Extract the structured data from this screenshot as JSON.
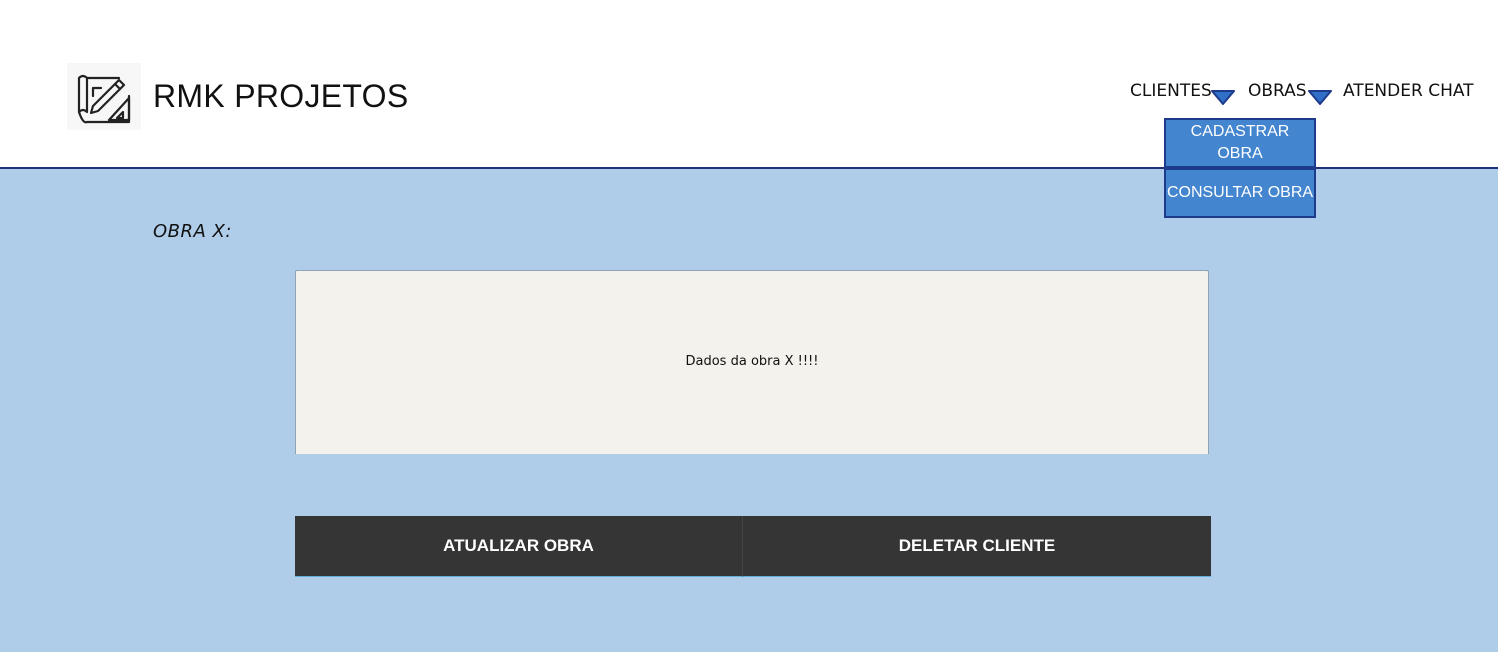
{
  "header": {
    "brand": "RMK PROJETOS",
    "logo_icon": "blueprint-pencil-icon"
  },
  "nav": {
    "clientes_label": "CLIENTES",
    "obras_label": "OBRAS",
    "chat_label": "ATENDER CHAT",
    "caret_icon": "caret-down-icon"
  },
  "obras_menu": {
    "items": [
      {
        "label": "CADASTRAR OBRA"
      },
      {
        "label": "CONSULTAR OBRA"
      }
    ]
  },
  "main": {
    "title": "OBRA X:",
    "details_text": "Dados da obra X !!!!"
  },
  "actions": {
    "update_label": "ATUALIZAR OBRA",
    "delete_label": "DELETAR CLIENTE"
  },
  "colors": {
    "background": "#afcde9",
    "header_border": "#1f2f7a",
    "dropdown_bg": "#4485cf",
    "button_bg": "#353535",
    "panel_bg": "#f3f2ec"
  }
}
